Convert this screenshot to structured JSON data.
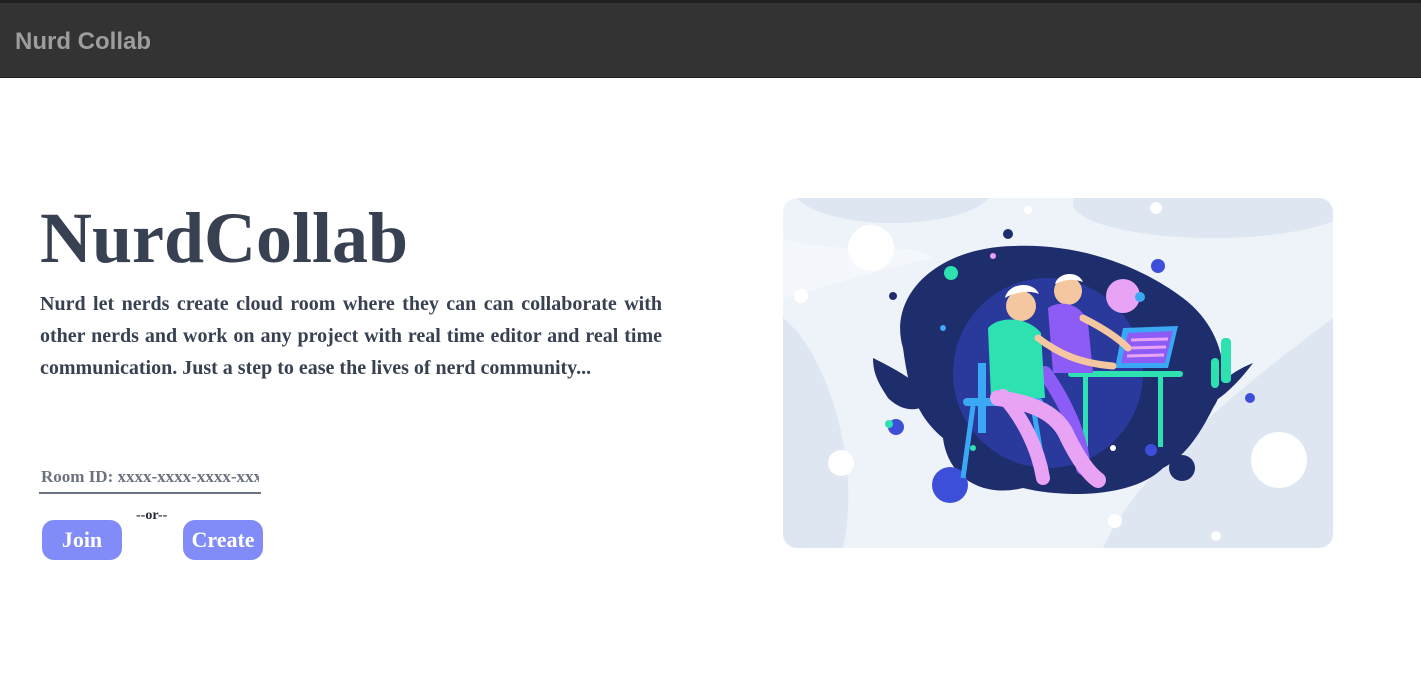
{
  "navbar": {
    "brand": "Nurd Collab",
    "background": "#333333",
    "brand_color": "#9d9d9d"
  },
  "hero": {
    "title": "NurdCollab",
    "description": "Nurd let nerds create cloud room where they can can collaborate with other nerds and work on any project with real time editor and real time communication. Just a step to ease the lives of nerd community...",
    "text_color": "#374151"
  },
  "room": {
    "placeholder": "Room ID: xxxx-xxxx-xxxx-xxxx",
    "value": ""
  },
  "actions": {
    "join_label": "Join",
    "separator": "--or--",
    "create_label": "Create",
    "button_color": "#818cf8"
  },
  "illustration": {
    "icon": "collaboration-illustration"
  }
}
